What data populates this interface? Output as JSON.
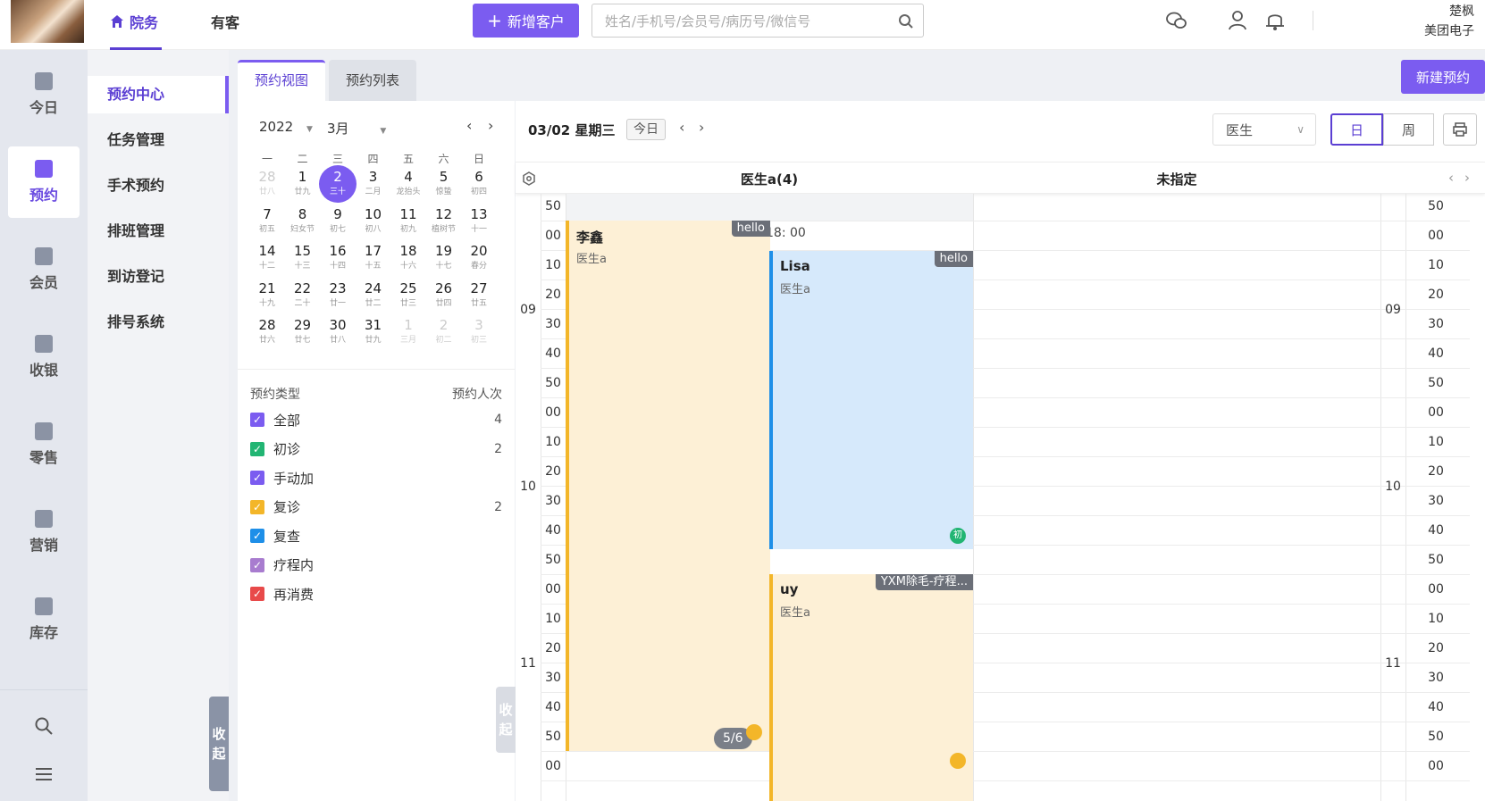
{
  "topbar": {
    "nav": [
      {
        "label": "院务",
        "active": true
      },
      {
        "label": "有客",
        "active": false
      }
    ],
    "add_customer_label": "新增客户",
    "search_placeholder": "姓名/手机号/会员号/病历号/微信号",
    "user_name": "楚枫",
    "org_name": "美团电子"
  },
  "leftbar": {
    "items": [
      {
        "label": "今日",
        "icon": "chart-icon"
      },
      {
        "label": "预约",
        "icon": "calendar-check-icon",
        "active": true
      },
      {
        "label": "会员",
        "icon": "member-icon"
      },
      {
        "label": "收银",
        "icon": "yen-icon"
      },
      {
        "label": "零售",
        "icon": "bag-icon"
      },
      {
        "label": "营销",
        "icon": "bookmark-icon"
      },
      {
        "label": "库存",
        "icon": "box-icon"
      }
    ]
  },
  "subnav": {
    "items": [
      "预约中心",
      "任务管理",
      "手术预约",
      "排班管理",
      "到访登记",
      "排号系统"
    ],
    "active": 0,
    "collapse_label_1": "收",
    "collapse_label_2": "起"
  },
  "tabs": [
    "预约视图",
    "预约列表"
  ],
  "new_appointment_label": "新建预约",
  "calendar": {
    "year": "2022",
    "month": "3月",
    "weekdays": [
      "一",
      "二",
      "三",
      "四",
      "五",
      "六",
      "日"
    ],
    "weeks": [
      [
        {
          "d": "28",
          "l": "廿八",
          "o": true
        },
        {
          "d": "1",
          "l": "廿九"
        },
        {
          "d": "2",
          "l": "三十",
          "sel": true
        },
        {
          "d": "3",
          "l": "二月"
        },
        {
          "d": "4",
          "l": "龙抬头"
        },
        {
          "d": "5",
          "l": "惊蛰"
        },
        {
          "d": "6",
          "l": "初四"
        }
      ],
      [
        {
          "d": "7",
          "l": "初五"
        },
        {
          "d": "8",
          "l": "妇女节"
        },
        {
          "d": "9",
          "l": "初七"
        },
        {
          "d": "10",
          "l": "初八"
        },
        {
          "d": "11",
          "l": "初九"
        },
        {
          "d": "12",
          "l": "植树节"
        },
        {
          "d": "13",
          "l": "十一"
        }
      ],
      [
        {
          "d": "14",
          "l": "十二"
        },
        {
          "d": "15",
          "l": "十三"
        },
        {
          "d": "16",
          "l": "十四"
        },
        {
          "d": "17",
          "l": "十五"
        },
        {
          "d": "18",
          "l": "十六"
        },
        {
          "d": "19",
          "l": "十七"
        },
        {
          "d": "20",
          "l": "春分"
        }
      ],
      [
        {
          "d": "21",
          "l": "十九"
        },
        {
          "d": "22",
          "l": "二十"
        },
        {
          "d": "23",
          "l": "廿一"
        },
        {
          "d": "24",
          "l": "廿二"
        },
        {
          "d": "25",
          "l": "廿三"
        },
        {
          "d": "26",
          "l": "廿四"
        },
        {
          "d": "27",
          "l": "廿五"
        }
      ],
      [
        {
          "d": "28",
          "l": "廿六"
        },
        {
          "d": "29",
          "l": "廿七"
        },
        {
          "d": "30",
          "l": "廿八"
        },
        {
          "d": "31",
          "l": "廿九"
        },
        {
          "d": "1",
          "l": "三月",
          "o": true
        },
        {
          "d": "2",
          "l": "初二",
          "o": true
        },
        {
          "d": "3",
          "l": "初三",
          "o": true
        }
      ]
    ]
  },
  "legend": {
    "type_header": "预约类型",
    "count_header": "预约人次",
    "rows": [
      {
        "label": "全部",
        "count": "4",
        "color": "#7b5cf0"
      },
      {
        "label": "初诊",
        "count": "2",
        "color": "#22b573"
      },
      {
        "label": "手动加",
        "count": "",
        "color": "#7b5cf0"
      },
      {
        "label": "复诊",
        "count": "2",
        "color": "#f3b629"
      },
      {
        "label": "复查",
        "count": "",
        "color": "#1e8fe8"
      },
      {
        "label": "疗程内",
        "count": "",
        "color": "#a87ccf"
      },
      {
        "label": "再消费",
        "count": "",
        "color": "#e84a4a"
      }
    ]
  },
  "schedule": {
    "date_title": "03/02 星期三",
    "today_label": "今日",
    "doctor_select": "医生",
    "view_day": "日",
    "view_week": "周",
    "columns": [
      "医生a(4)",
      "未指定"
    ],
    "time_marker": "18: 00",
    "minute_labels": [
      "50",
      "00",
      "10",
      "20",
      "30",
      "40",
      "50",
      "00",
      "10",
      "20",
      "30",
      "40",
      "50",
      "00",
      "10",
      "20",
      "30",
      "40",
      "50",
      "00"
    ],
    "hour_labels": [
      "09",
      "10",
      "11"
    ],
    "appointments": [
      {
        "name": "李鑫",
        "doctor": "医生a",
        "tag": "hello",
        "color": "#fdf0d6",
        "border": "#f3b629"
      },
      {
        "name": "Lisa",
        "doctor": "医生a",
        "tag": "hello",
        "color": "#d6e9fb",
        "border": "#1e8fe8",
        "badge": "初"
      },
      {
        "name": "uy",
        "doctor": "医生a",
        "tag": "YXM除毛-疗程...",
        "color": "#fdf0d6",
        "border": "#f3b629"
      }
    ],
    "count_pill": "5/6"
  }
}
